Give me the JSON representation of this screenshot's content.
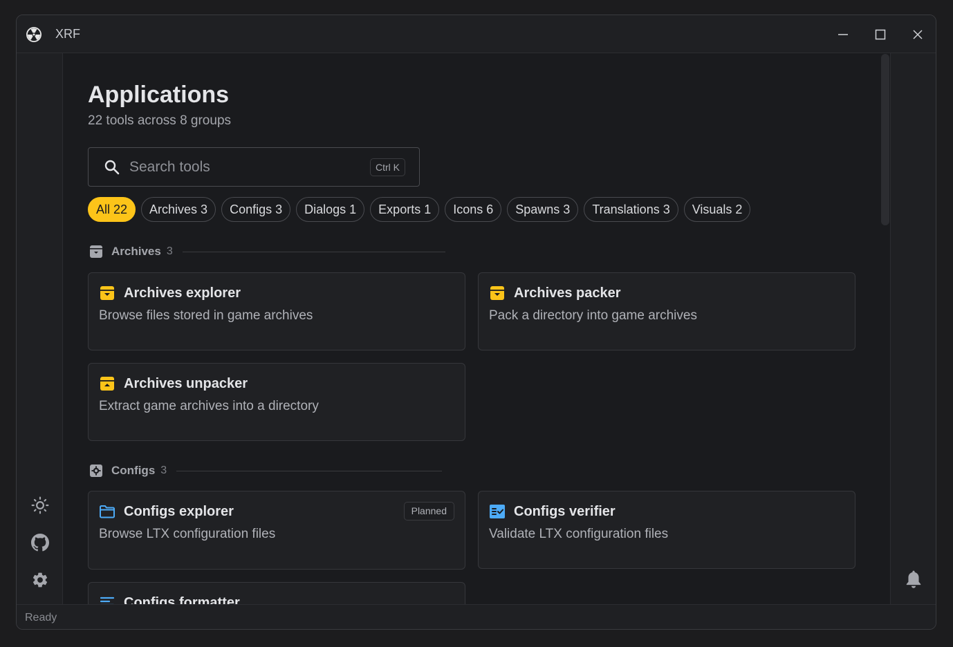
{
  "window": {
    "title": "XRF"
  },
  "header": {
    "title": "Applications",
    "subtitle": "22 tools across 8 groups"
  },
  "search": {
    "placeholder": "Search tools",
    "value": "",
    "shortcut": "Ctrl K"
  },
  "filters": [
    {
      "label": "All 22",
      "active": true
    },
    {
      "label": "Archives 3",
      "active": false
    },
    {
      "label": "Configs 3",
      "active": false
    },
    {
      "label": "Dialogs 1",
      "active": false
    },
    {
      "label": "Exports 1",
      "active": false
    },
    {
      "label": "Icons 6",
      "active": false
    },
    {
      "label": "Spawns 3",
      "active": false
    },
    {
      "label": "Translations 3",
      "active": false
    },
    {
      "label": "Visuals 2",
      "active": false
    }
  ],
  "sections": {
    "archives": {
      "name": "Archives",
      "count": "3",
      "icon": "archive-box-icon",
      "cards": [
        {
          "title": "Archives explorer",
          "desc": "Browse files stored in game archives",
          "icon": "archive-down-icon"
        },
        {
          "title": "Archives packer",
          "desc": "Pack a directory into game archives",
          "icon": "archive-down-icon"
        },
        {
          "title": "Archives unpacker",
          "desc": "Extract game archives into a directory",
          "icon": "archive-up-icon"
        }
      ]
    },
    "configs": {
      "name": "Configs",
      "count": "3",
      "icon": "config-gear-icon",
      "cards": [
        {
          "title": "Configs explorer",
          "desc": "Browse LTX configuration files",
          "icon": "folder-icon",
          "badge": "Planned"
        },
        {
          "title": "Configs verifier",
          "desc": "Validate LTX configuration files",
          "icon": "checklist-icon"
        },
        {
          "title": "Configs formatter",
          "desc": "",
          "icon": "align-left-icon"
        }
      ]
    }
  },
  "status": {
    "text": "Ready"
  },
  "colors": {
    "accent": "#fcc419",
    "blue": "#4dabf7",
    "background": "#1a1b1e"
  }
}
